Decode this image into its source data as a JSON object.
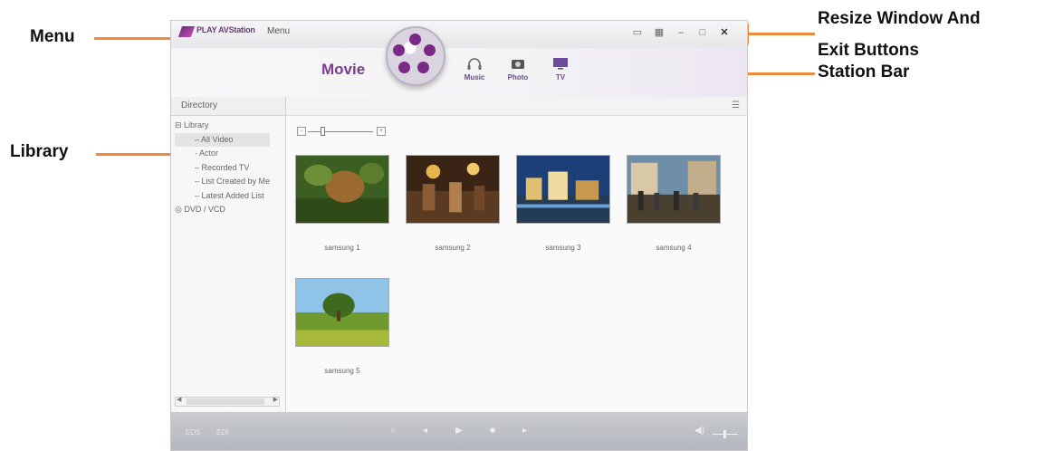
{
  "annotations": {
    "menu": "Menu",
    "library": "Library",
    "resize_exit_line1": "Resize Window And",
    "resize_exit_line2": "Exit Buttons",
    "station_bar": "Station Bar",
    "accent_color": "#f0883a"
  },
  "app": {
    "name": "PLAY AVStation",
    "menu_label": "Menu",
    "window_controls": [
      "screen-mode-icon",
      "layout-icon",
      "minimize-icon",
      "maximize-icon",
      "close-icon"
    ]
  },
  "station_bar": {
    "active": "Movie",
    "stations": [
      {
        "label": "Music",
        "icon": "headphones-icon"
      },
      {
        "label": "Photo",
        "icon": "camera-icon"
      },
      {
        "label": "TV",
        "icon": "tv-icon"
      }
    ]
  },
  "sidebar": {
    "header": "Directory",
    "library_label": "Library",
    "items": [
      "All Video",
      "Actor",
      "Recorded TV",
      "List Created by Me",
      "Latest Added List"
    ],
    "dvd_label": "DVD / VCD"
  },
  "main": {
    "videos": [
      {
        "title": "samsung 1"
      },
      {
        "title": "samsung 2"
      },
      {
        "title": "samsung 3"
      },
      {
        "title": "samsung 4"
      },
      {
        "title": "samsung 5"
      }
    ]
  },
  "playbar": {
    "left_labels": [
      "EDS",
      "EDI"
    ]
  },
  "colors": {
    "brand_purple": "#7b3c92",
    "window_bg": "#f1f1f1",
    "playbar_bg": "#b9bcc2"
  }
}
